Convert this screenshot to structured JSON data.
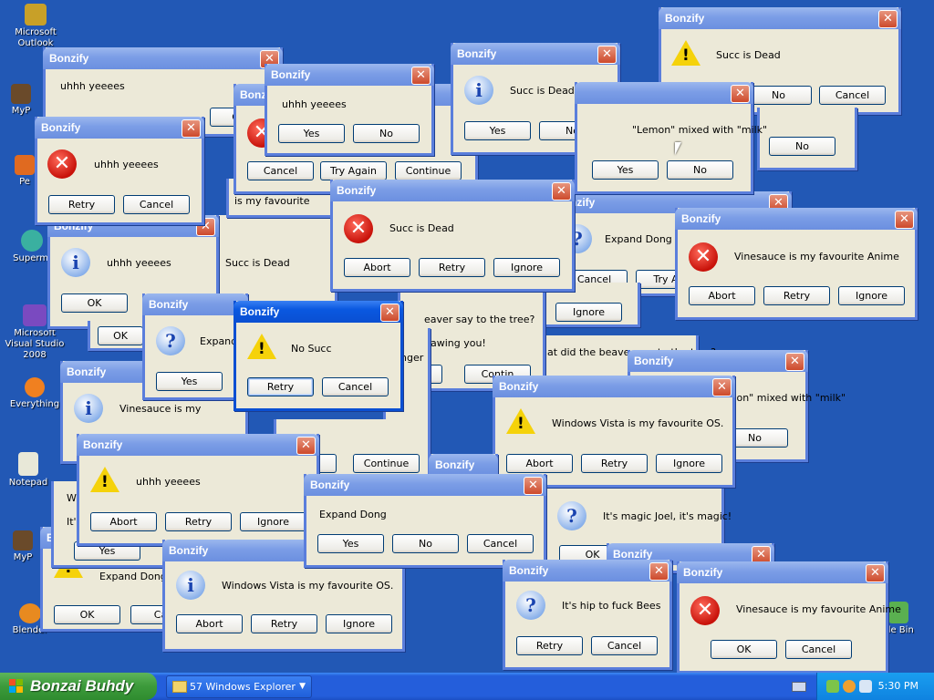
{
  "desktop_icons": [
    {
      "label": "Microsoft Outlook",
      "icon": "outlook-icon",
      "color": "#c8a028"
    },
    {
      "label": "MyP",
      "icon": "mypet-icon",
      "color": "#6a4a2a"
    },
    {
      "label": "Pe",
      "icon": "paint-icon",
      "color": "#e06a20"
    },
    {
      "label": "Supermi",
      "icon": "globe-icon",
      "color": "#3ab0a0"
    },
    {
      "label": "Microsoft Visual Studio 2008",
      "icon": "visual-studio-icon",
      "color": "#7a4ac0"
    },
    {
      "label": "Everything",
      "icon": "everything-icon",
      "color": "#f08020"
    },
    {
      "label": "Notepad",
      "icon": "notepad-icon",
      "color": "#e8e8d8"
    },
    {
      "label": "MyP",
      "icon": "mypet-icon",
      "color": "#6a4a2a"
    },
    {
      "label": "Blender",
      "icon": "blender-icon",
      "color": "#e88a20"
    },
    {
      "label": "cle Bin",
      "icon": "recycle-bin-icon",
      "color": "#5ab050"
    }
  ],
  "window_title": "Bonzify",
  "close_glyph": "✕",
  "dialogs": [
    {
      "icon": "info",
      "message": "uhhh yeeees",
      "buttons": [
        "Yes",
        "No"
      ]
    },
    {
      "icon": "warning",
      "message": "Succ is Dead",
      "buttons": [
        "No",
        "Cancel"
      ]
    },
    {
      "icon": "question",
      "message": "Expand Dong",
      "buttons": [
        "Cancel",
        "Try Ag"
      ]
    },
    {
      "icon": "info",
      "message": "Vinesauce is my",
      "buttons": []
    },
    {
      "icon": "info",
      "message": "\"Lemon\" mixed with \"milk\"",
      "buttons": [
        "No"
      ]
    },
    {
      "icon": "info",
      "message": "It's magic Joel, it's magic!",
      "buttons": [
        "OK"
      ]
    },
    {
      "icon": "warning",
      "message": "Expand Dong",
      "buttons": [
        "Yes",
        "OK",
        "Can"
      ]
    },
    {
      "icon": "info",
      "message": "Succ is Dead",
      "buttons": [
        "OK"
      ]
    },
    {
      "icon": "warning",
      "message": "hat did the beaver say to the tree?",
      "buttons": [
        "Ignore",
        "ain",
        "Contin"
      ]
    },
    {
      "icon": "info",
      "message": "is my favourite",
      "buttons": [
        "Cancel",
        "Try Again",
        "Continue"
      ]
    },
    {
      "icon": "error",
      "message": "uhhh yeeees",
      "buttons": [
        "Cancel",
        "Try Again",
        "Continue"
      ]
    },
    {
      "icon": "info",
      "message": "uhhh yeeees",
      "buttons": [
        "Yes",
        "No"
      ]
    },
    {
      "icon": "info",
      "message": "uhhh yeeees",
      "buttons": [
        "OK",
        "OK"
      ]
    },
    {
      "icon": "error",
      "message": "uhhh yeeees",
      "buttons": [
        "Retry",
        "Cancel"
      ]
    },
    {
      "icon": "question",
      "message": "Expand",
      "buttons": [
        "Yes"
      ]
    },
    {
      "icon": "error",
      "message": "Succ is Dead",
      "buttons": [
        "Abort",
        "Retry",
        "Ignore"
      ]
    },
    {
      "icon": "info",
      "message": "Succ is Dead",
      "buttons": [
        "Yes",
        "No"
      ]
    },
    {
      "icon": "info",
      "message": "\"Lemon\" mixed with \"milk\"",
      "buttons": [
        "Yes",
        "No"
      ]
    },
    {
      "icon": "error",
      "message": "Vinesauce is my favourite Anime",
      "buttons": [
        "Abort",
        "Retry",
        "Ignore"
      ]
    },
    {
      "icon": "warning",
      "message": "Windows Vista is my favourite OS.",
      "buttons": [
        "Abort",
        "Retry",
        "Ignore"
      ]
    },
    {
      "icon": "warning",
      "message": "uhhh yeeees",
      "buttons": [
        "Abort",
        "Retry",
        "Ignore"
      ]
    },
    {
      "icon": "info",
      "message": "Windows Vista is my favourite OS.",
      "buttons": [
        "Abort",
        "Retry",
        "Ignore"
      ]
    },
    {
      "icon": "info",
      "message": "Expand Dong",
      "buttons": [
        "Yes",
        "No",
        "Cancel"
      ]
    },
    {
      "icon": "question",
      "message": "It's hip to fuck Bees",
      "buttons": [
        "Retry",
        "Cancel"
      ]
    },
    {
      "icon": "error",
      "message": "Vinesauce is my favourite Anime",
      "buttons": [
        "OK",
        "Cancel"
      ]
    },
    {
      "icon": "warning",
      "message": "No Succ",
      "buttons": [
        "Retry",
        "Cancel"
      ]
    }
  ],
  "partial_texts": {
    "wh": "Wh",
    "its": "It's",
    "beaver_lines": [
      "eaver say to the tree?",
      "hawing you!",
      "nger"
    ],
    "con": "Con",
    "con2": "n",
    "cont": "Continue"
  },
  "taskbar": {
    "start_label": "Bonzai Buhdy",
    "task_button": "57 Windows Explorer",
    "clock": "5:30 PM"
  },
  "colors": {
    "desktop": "#2258b5",
    "active_title": "#0a4fd2",
    "inactive_title": "#7b9de6",
    "dialog_face": "#ece9d8",
    "start_green": "#3c9a3b",
    "tray_blue": "#0f83e0"
  }
}
